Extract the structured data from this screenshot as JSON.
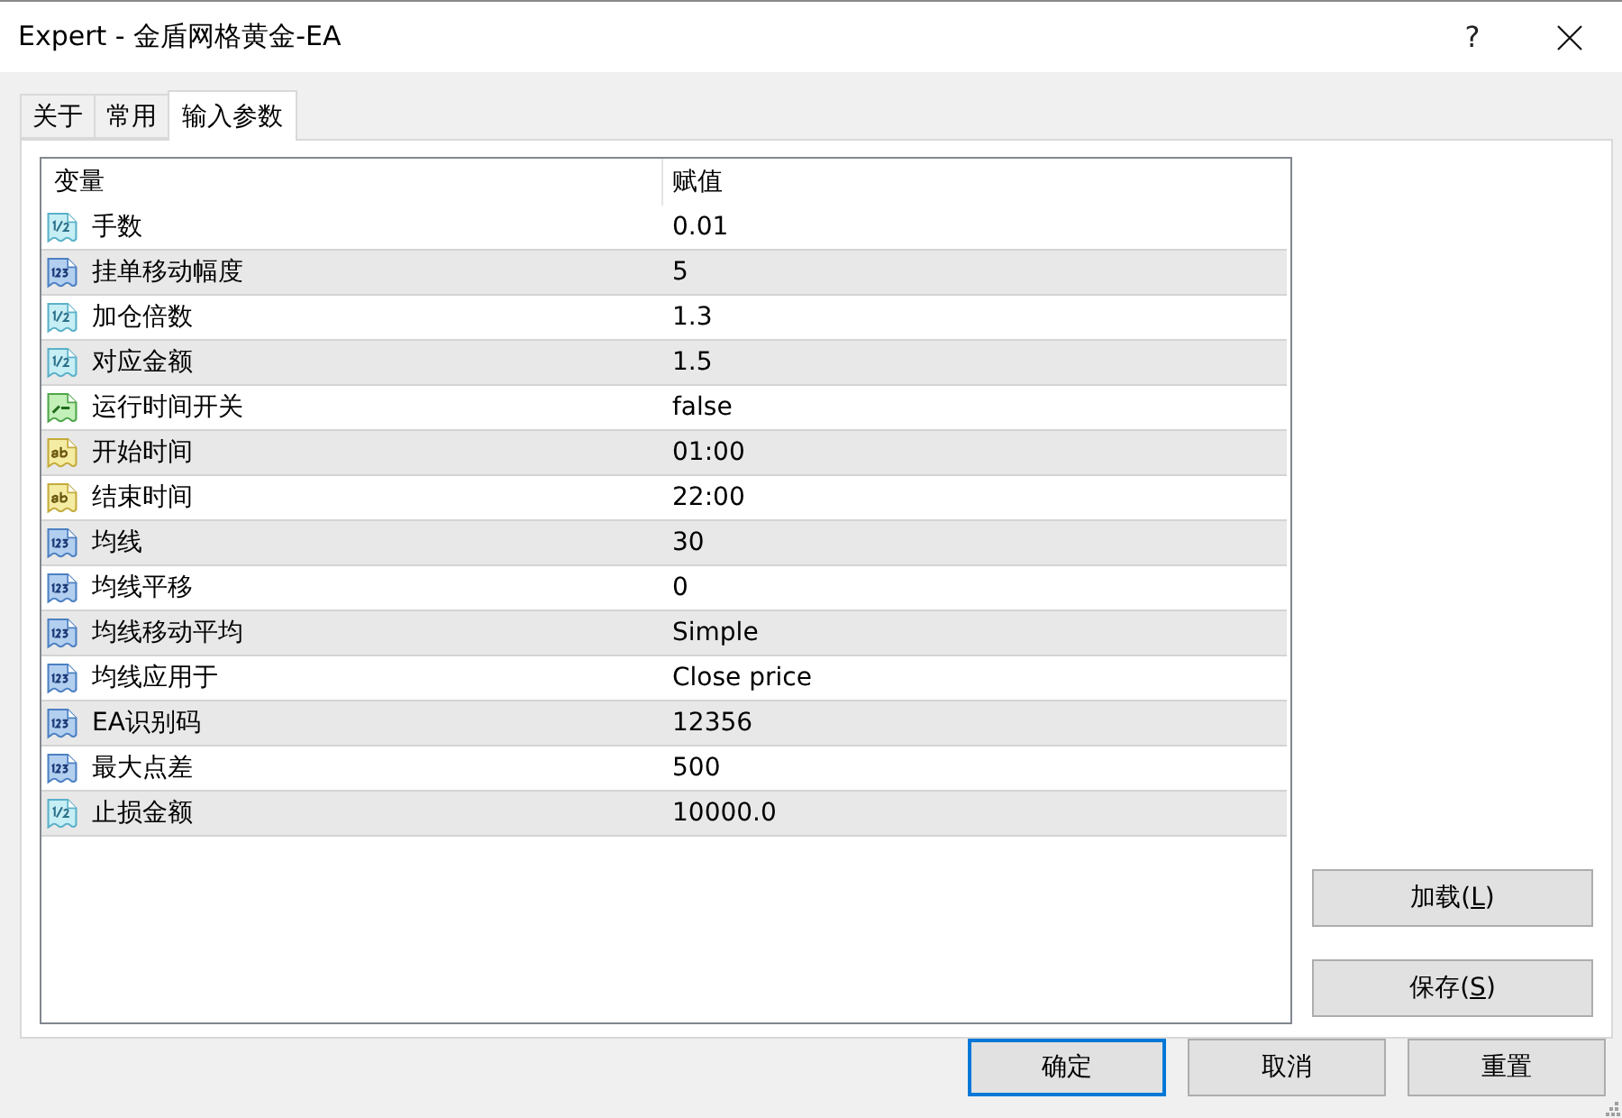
{
  "window": {
    "title": "Expert - 金盾网格黄金-EA",
    "help": "?"
  },
  "tabs": [
    {
      "label": "关于",
      "selected": false
    },
    {
      "label": "常用",
      "selected": false
    },
    {
      "label": "输入参数",
      "selected": true
    }
  ],
  "table": {
    "columns": [
      "变量",
      "赋值"
    ],
    "rows": [
      {
        "kind": "double",
        "name": "手数",
        "value": "0.01"
      },
      {
        "kind": "int",
        "name": "挂单移动幅度",
        "value": "5"
      },
      {
        "kind": "double",
        "name": "加仓倍数",
        "value": "1.3"
      },
      {
        "kind": "double",
        "name": "对应金额",
        "value": "1.5"
      },
      {
        "kind": "bool",
        "name": "运行时间开关",
        "value": "false"
      },
      {
        "kind": "string",
        "name": "开始时间",
        "value": "01:00"
      },
      {
        "kind": "string",
        "name": "结束时间",
        "value": "22:00"
      },
      {
        "kind": "int",
        "name": "均线",
        "value": "30"
      },
      {
        "kind": "int",
        "name": "均线平移",
        "value": "0"
      },
      {
        "kind": "int",
        "name": "均线移动平均",
        "value": "Simple"
      },
      {
        "kind": "int",
        "name": "均线应用于",
        "value": "Close price"
      },
      {
        "kind": "int",
        "name": "EA识别码",
        "value": "12356"
      },
      {
        "kind": "int",
        "name": "最大点差",
        "value": "500"
      },
      {
        "kind": "double",
        "name": "止损金额",
        "value": "10000.0"
      }
    ]
  },
  "side_buttons": [
    {
      "before": "加载(",
      "hotkey": "L",
      "after": ")"
    },
    {
      "before": "保存(",
      "hotkey": "S",
      "after": ")"
    }
  ],
  "buttons": [
    {
      "label": "确定",
      "focused": true
    },
    {
      "label": "取消",
      "focused": false
    },
    {
      "label": "重置",
      "focused": false
    }
  ]
}
